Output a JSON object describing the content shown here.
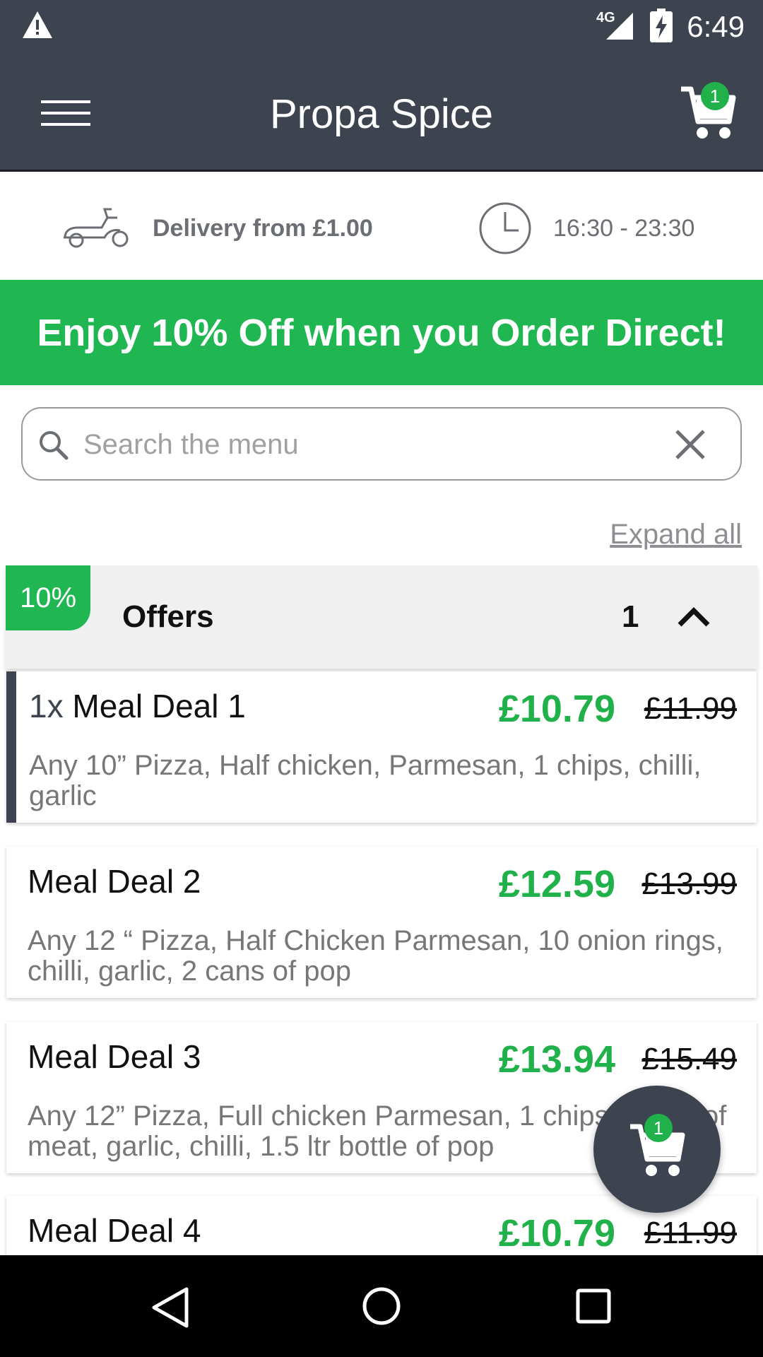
{
  "status_bar": {
    "network": "4G",
    "time": "6:49"
  },
  "app_bar": {
    "title": "Propa Spice",
    "cart_count": "1",
    "menu_icon": "hamburger-menu-icon",
    "cart_icon": "shopping-cart-icon"
  },
  "info": {
    "delivery": "Delivery from £1.00",
    "hours": "16:30 - 23:30"
  },
  "promo": {
    "text": "Enjoy 10% Off when you Order Direct!"
  },
  "search": {
    "placeholder": "Search the menu",
    "value": ""
  },
  "expand_all": "Expand all",
  "category": {
    "tag": "10%",
    "name": "Offers",
    "count": "1"
  },
  "items": [
    {
      "qty": "1x",
      "title": "Meal Deal 1",
      "price": "£10.79",
      "old_price": "£11.99",
      "description": "Any 10” Pizza, Half chicken, Parmesan, 1 chips, chilli, garlic"
    },
    {
      "title": "Meal Deal 2",
      "price": "£12.59",
      "old_price": "£13.99",
      "description": "Any 12 “ Pizza, Half Chicken Parmesan, 10 onion rings, chilli, garlic, 2 cans of pop"
    },
    {
      "title": "Meal Deal 3",
      "price": "£13.94",
      "old_price": "£15.49",
      "description": "Any 12” Pizza, Full chicken Parmesan, 1 chips, 1 tray of meat, garlic, chilli, 1.5 ltr bottle of pop"
    },
    {
      "title": "Meal Deal 4",
      "price": "£10.79",
      "old_price": "£11.99"
    }
  ],
  "fab": {
    "cart_count": "1"
  },
  "colors": {
    "primary_dark": "#3d4450",
    "accent_green": "#20b753",
    "price_green": "#20b14a"
  }
}
